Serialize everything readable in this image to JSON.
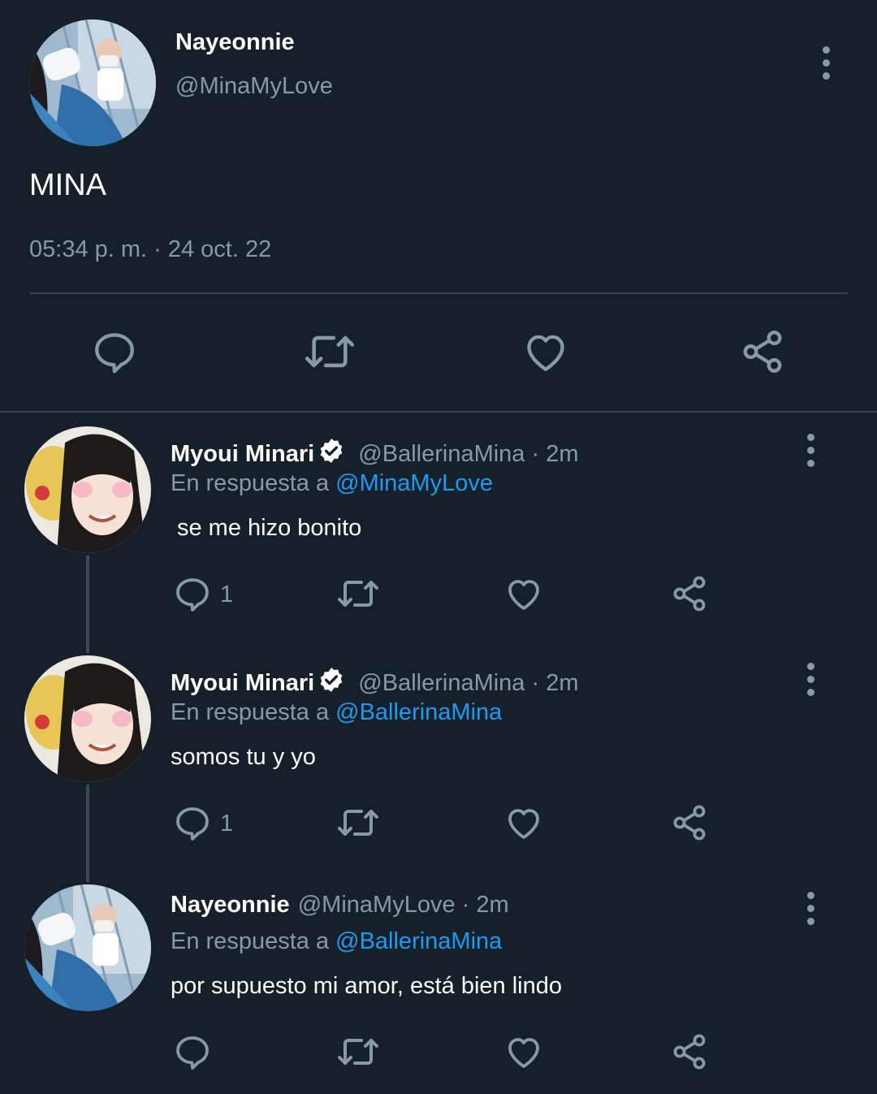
{
  "main_tweet": {
    "display_name": "Nayeonnie",
    "handle": "@MinaMyLove",
    "text": "MINA",
    "timestamp": "05:34 p. m. · 24 oct. 22",
    "actions": [
      "reply-icon",
      "retweet-icon",
      "like-icon",
      "share-icon"
    ]
  },
  "replies": [
    {
      "display_name": "Myoui Minari",
      "verified": true,
      "handle": "@BallerinaMina",
      "time": "· 2m",
      "reply_prefix": "En respuesta a",
      "reply_to": "@MinaMyLove",
      "text": "se me hizo bonito",
      "reply_count": "1"
    },
    {
      "display_name": "Myoui Minari",
      "verified": true,
      "handle": "@BallerinaMina",
      "time": "· 2m",
      "reply_prefix": "En respuesta a",
      "reply_to": "@BallerinaMina",
      "text": "somos tu y yo",
      "reply_count": "1"
    },
    {
      "display_name": "Nayeonnie",
      "verified": false,
      "handle": "@MinaMyLove",
      "time": "· 2m",
      "reply_prefix": "En respuesta a",
      "reply_to": "@BallerinaMina",
      "text": "por supuesto mi amor, está bien lindo",
      "reply_count": ""
    }
  ],
  "colors": {
    "background": "#15202b",
    "muted_text": "#8899a6",
    "link": "#1d9bf0",
    "divider": "#38444d"
  }
}
